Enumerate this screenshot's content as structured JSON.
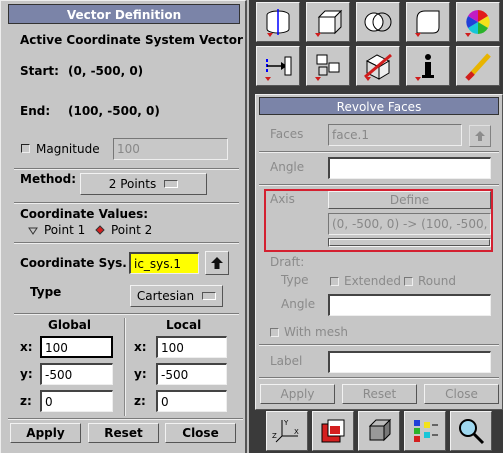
{
  "vector": {
    "title": "Vector Definition",
    "subtitle": "Active Coordinate System Vector",
    "start_label": "Start:",
    "start_value": "(0, -500, 0)",
    "end_label": "End:",
    "end_value": "(100, -500, 0)",
    "magnitude_label": "Magnitude",
    "magnitude_value": "100",
    "method_label": "Method:",
    "method_value": "2 Points",
    "coord_values_label": "Coordinate Values:",
    "point1_label": "Point 1",
    "point2_label": "Point 2",
    "coord_sys_label": "Coordinate Sys.",
    "coord_sys_value": "ic_sys.1",
    "type_label": "Type",
    "type_value": "Cartesian",
    "global_label": "Global",
    "local_label": "Local",
    "global": [
      {
        "axis": "x:",
        "value": "100"
      },
      {
        "axis": "y:",
        "value": "-500"
      },
      {
        "axis": "z:",
        "value": "0"
      }
    ],
    "local": [
      {
        "axis": "x:",
        "value": "100"
      },
      {
        "axis": "y:",
        "value": "-500"
      },
      {
        "axis": "z:",
        "value": "0"
      }
    ],
    "apply_label": "Apply",
    "reset_label": "Reset",
    "close_label": "Close"
  },
  "revolve": {
    "title": "Revolve Faces",
    "faces_label": "Faces",
    "faces_value": "face.1",
    "angle_label": "Angle",
    "axis_label": "Axis",
    "define_label": "Define",
    "axis_value": "(0, -500, 0) -> (100, -500,",
    "draft_label": "Draft:",
    "draft_type_label": "Type",
    "extended_label": "Extended",
    "round_label": "Round",
    "draft_angle_label": "Angle",
    "with_mesh_label": "With mesh",
    "label_label": "Label",
    "apply_label": "Apply",
    "reset_label": "Reset",
    "close_label": "Close"
  },
  "colors": {
    "title_bar": "#7b84a8",
    "highlight_field": "#ffff00",
    "axis_box": "#d42030",
    "toolbar_bg": "#3a3a3a"
  },
  "icons": {
    "top_row": [
      "cylinder-shape-icon",
      "box-shape-icon",
      "intersecting-circles-icon",
      "rounded-box-icon",
      "color-wheel-icon"
    ],
    "second_row": [
      "transform-arrow-icon",
      "create-block-icon",
      "delete-shape-icon",
      "info-icon",
      "eraser-icon"
    ],
    "bottom_row": [
      "axis-triad-icon",
      "shaded-view-icon",
      "solid-cube-icon",
      "render-mode-icon",
      "zoom-magnifier-icon"
    ]
  }
}
